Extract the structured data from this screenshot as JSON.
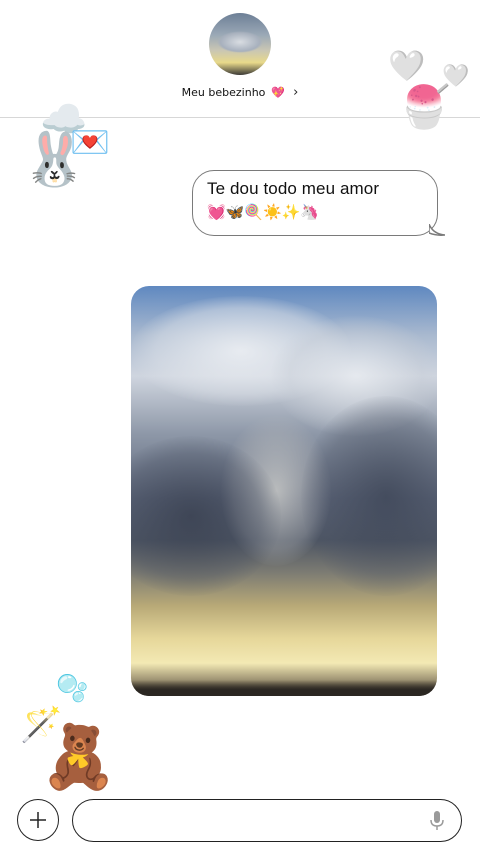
{
  "header": {
    "contact_name": "Meu bebezinho",
    "contact_emoji": "💖",
    "chevron": "›"
  },
  "stickers": {
    "hearts": "🤍",
    "shaved_ice": "🍧",
    "cloud": "☁️",
    "letter": "💌",
    "bunny": "🐰",
    "bubbles": "🫧",
    "wand": "🪄",
    "teddy": "🧸"
  },
  "message": {
    "text": "Te dou todo meu amor",
    "emojis": "💓🦋🍭☀️✨🦄"
  },
  "photo": {
    "description_icon": "sky-photo"
  },
  "composer": {
    "placeholder": "",
    "value": ""
  }
}
